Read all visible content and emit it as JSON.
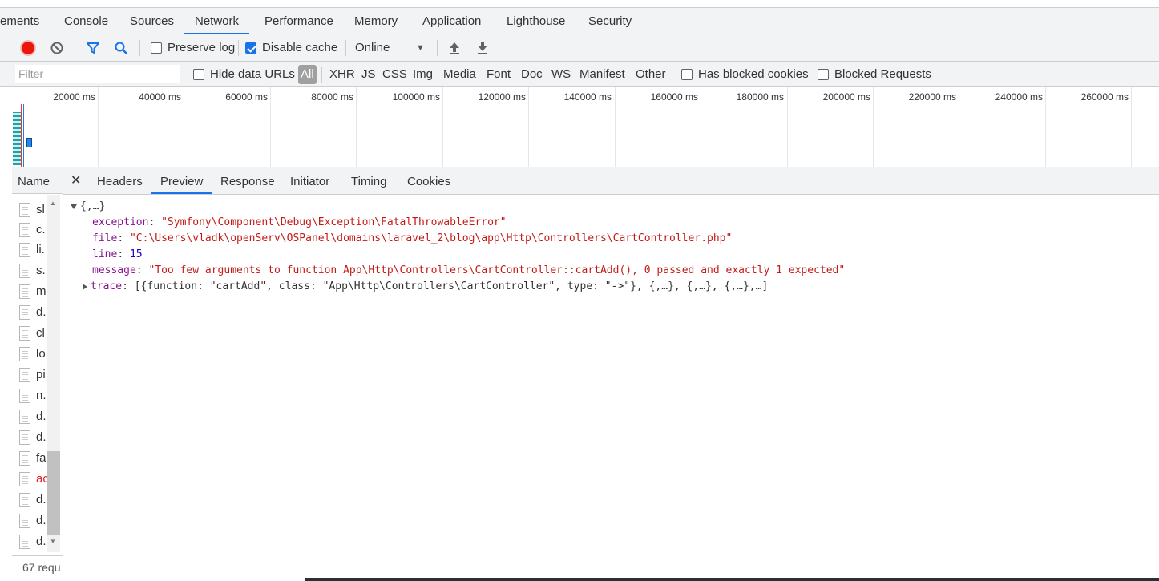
{
  "tabs": [
    "ements",
    "Console",
    "Sources",
    "Network",
    "Performance",
    "Memory",
    "Application",
    "Lighthouse",
    "Security"
  ],
  "toolbar": {
    "preserve_log": "Preserve log",
    "disable_cache": "Disable cache",
    "throttle": "Online",
    "preserve_log_checked": false,
    "disable_cache_checked": true
  },
  "filterbar": {
    "placeholder": "Filter",
    "hide_data_urls": "Hide data URLs",
    "types": [
      "All",
      "XHR",
      "JS",
      "CSS",
      "Img",
      "Media",
      "Font",
      "Doc",
      "WS",
      "Manifest",
      "Other"
    ],
    "has_blocked_cookies": "Has blocked cookies",
    "blocked_requests": "Blocked Requests"
  },
  "overview": {
    "ticks": [
      "20000 ms",
      "40000 ms",
      "60000 ms",
      "80000 ms",
      "100000 ms",
      "120000 ms",
      "140000 ms",
      "160000 ms",
      "180000 ms",
      "200000 ms",
      "220000 ms",
      "240000 ms",
      "260000 ms"
    ]
  },
  "namecol": {
    "header": "Name",
    "rows": [
      "sl",
      "c.",
      "li.",
      "s.",
      "m",
      "d.",
      "cl",
      "lo",
      "pi",
      "n.",
      "d.",
      "d.",
      "fa",
      "ac",
      "d.",
      "d.",
      "d."
    ],
    "status": "67 requ"
  },
  "detail_tabs": [
    "Headers",
    "Preview",
    "Response",
    "Initiator",
    "Timing",
    "Cookies"
  ],
  "colors": {
    "accent": "#1a73e8",
    "key": "#881391",
    "string": "#c41a16",
    "number": "#1c00cf",
    "record": "#e8160c"
  },
  "preview": {
    "root": "{,…}",
    "exception_key": "exception",
    "exception_val": "\"Symfony\\Component\\Debug\\Exception\\FatalThrowableError\"",
    "file_key": "file",
    "file_val": "\"C:\\Users\\vladk\\openServ\\OSPanel\\domains\\laravel_2\\blog\\app\\Http\\Controllers\\CartController.php\"",
    "line_key": "line",
    "line_val": "15",
    "message_key": "message",
    "message_val": "\"Too few arguments to function App\\Http\\Controllers\\CartController::cartAdd(), 0 passed and exactly 1 expected\"",
    "trace_key": "trace",
    "trace_val": "[{function: \"cartAdd\", class: \"App\\Http\\Controllers\\CartController\", type: \"->\"}, {,…}, {,…}, {,…},…]"
  }
}
